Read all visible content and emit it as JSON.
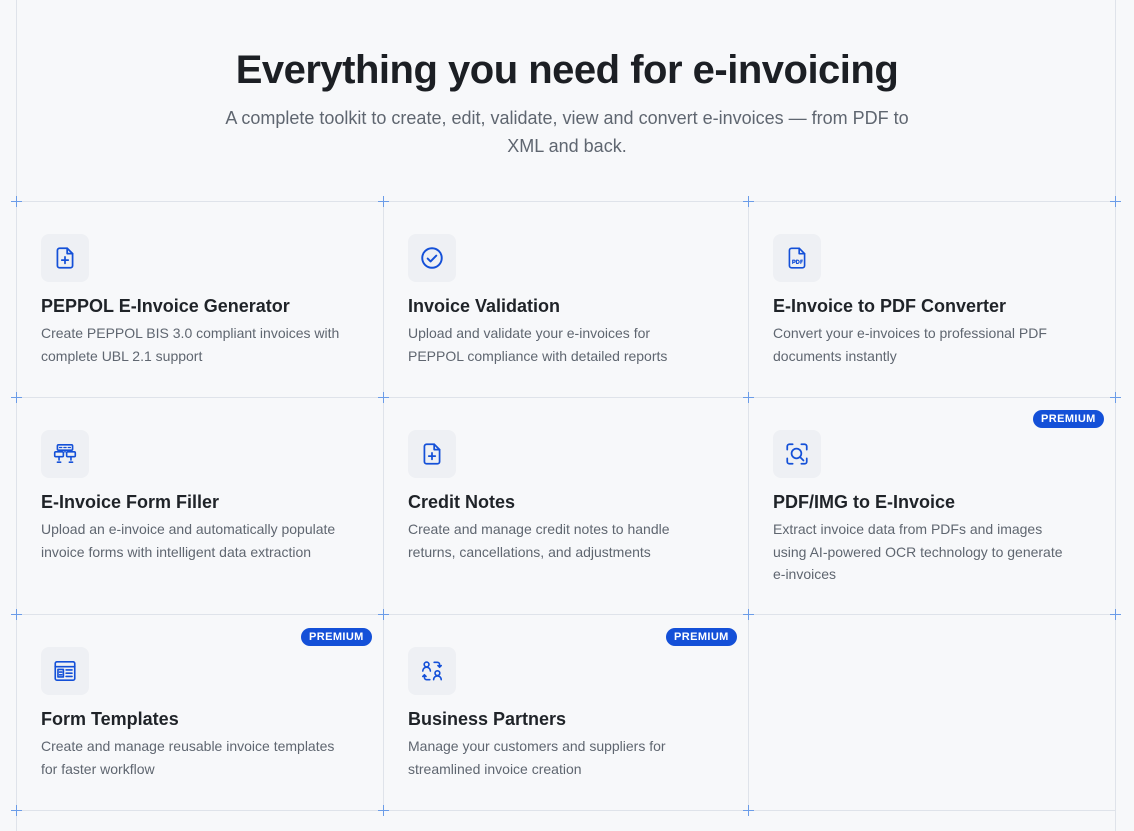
{
  "hero": {
    "title": "Everything you need for e-invoicing",
    "subtitle": "A complete toolkit to create, edit, validate, view and convert e-invoices — from PDF to XML and back."
  },
  "accent_color": "#1450d8",
  "features": [
    {
      "icon": "file-plus-icon",
      "title": "PEPPOL E-Invoice Generator",
      "description": "Create PEPPOL BIS 3.0 compliant invoices with complete UBL 2.1 support",
      "badge": ""
    },
    {
      "icon": "check-circle-icon",
      "title": "Invoice Validation",
      "description": "Upload and validate your e-invoices for PEPPOL compliance with detailed reports",
      "badge": ""
    },
    {
      "icon": "file-pdf-icon",
      "title": "E-Invoice to PDF Converter",
      "description": "Convert your e-invoices to professional PDF documents instantly",
      "badge": ""
    },
    {
      "icon": "form-fields-icon",
      "title": "E-Invoice Form Filler",
      "description": "Upload an e-invoice and automatically populate invoice forms with intelligent data extraction",
      "badge": ""
    },
    {
      "icon": "file-plus-icon",
      "title": "Credit Notes",
      "description": "Create and manage credit notes to handle returns, cancellations, and adjustments",
      "badge": ""
    },
    {
      "icon": "scan-search-icon",
      "title": "PDF/IMG to E-Invoice",
      "description": "Extract invoice data from PDFs and images using AI-powered OCR technology to generate e-invoices",
      "badge": "PREMIUM"
    },
    {
      "icon": "template-icon",
      "title": "Form Templates",
      "description": "Create and manage reusable invoice templates for faster workflow",
      "badge": "PREMIUM"
    },
    {
      "icon": "users-exchange-icon",
      "title": "Business Partners",
      "description": "Manage your customers and suppliers for streamlined invoice creation",
      "badge": "PREMIUM"
    }
  ]
}
